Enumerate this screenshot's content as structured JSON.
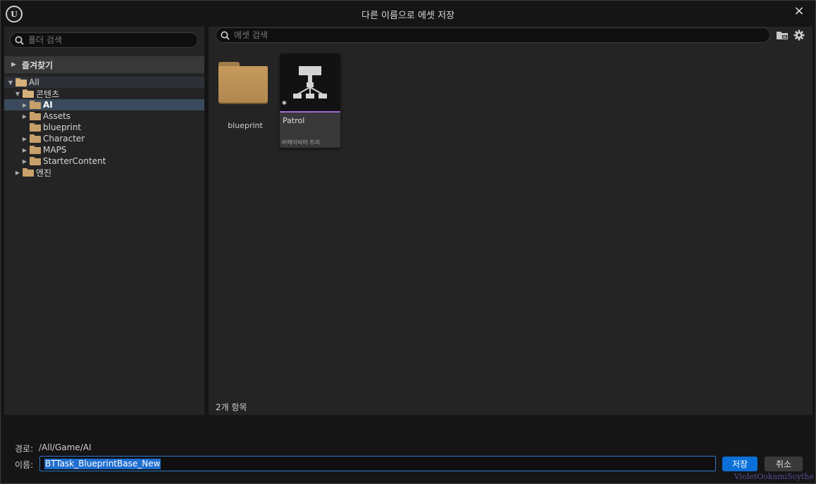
{
  "window": {
    "title": "다른 이름으로 에셋 저장",
    "logo_text": "U",
    "close_icon": "×"
  },
  "left": {
    "search_placeholder": "폴더 검색",
    "favorites_label": "즐겨찾기",
    "tree": [
      {
        "label": "All",
        "level": 0,
        "expanded": true,
        "root": true
      },
      {
        "label": "콘텐츠",
        "level": 1,
        "expanded": true
      },
      {
        "label": "AI",
        "level": 2,
        "expanded": false,
        "selected": true
      },
      {
        "label": "Assets",
        "level": 2,
        "expanded": false
      },
      {
        "label": "blueprint",
        "level": 2,
        "leaf": true
      },
      {
        "label": "Character",
        "level": 2,
        "expanded": false
      },
      {
        "label": "MAPS",
        "level": 2,
        "expanded": false
      },
      {
        "label": "StarterContent",
        "level": 2,
        "expanded": false
      },
      {
        "label": "엔진",
        "level": 1,
        "expanded": false
      }
    ]
  },
  "right": {
    "search_placeholder": "에셋 검색",
    "items": [
      {
        "name": "blueprint",
        "kind": "folder"
      },
      {
        "name": "Patrol",
        "kind": "asset",
        "type_label": "비헤이비어 트리",
        "badge": "*"
      }
    ],
    "item_count": "2개 항목"
  },
  "bottom": {
    "path_label": "경로:",
    "path_value": "/All/Game/AI",
    "name_label": "이름:",
    "name_value": "BTTask_BlueprintBase_New",
    "save_label": "저장",
    "cancel_label": "취소"
  },
  "watermark": "VioletOokamiScythe",
  "colors": {
    "accent": "#0a70d8",
    "selection": "#3a4a5c",
    "folder": "#c7a06a",
    "asset_strip": "#a068d8"
  }
}
